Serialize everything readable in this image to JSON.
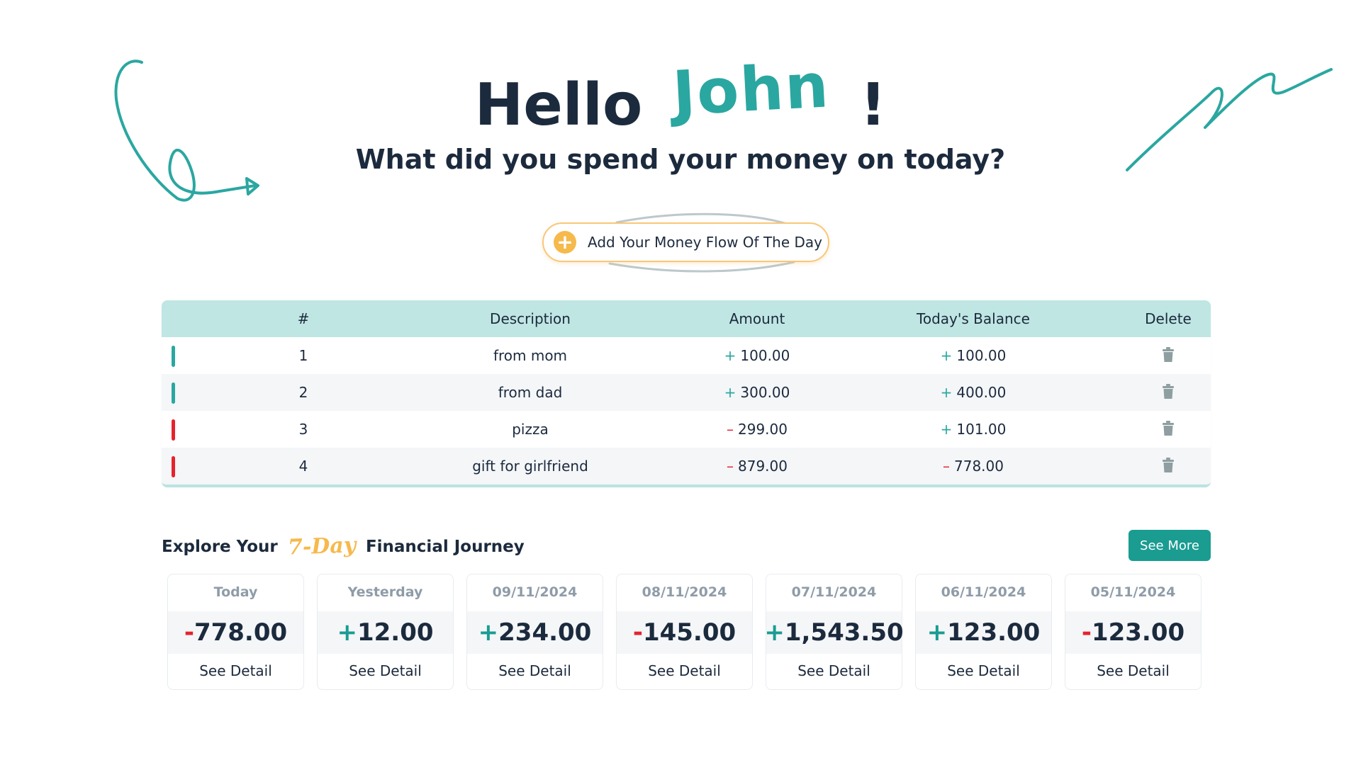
{
  "hero": {
    "greeting": "Hello",
    "name": "John",
    "exclaim": "!",
    "subtitle": "What did you spend your money on today?"
  },
  "add_button": {
    "label": "Add Your Money Flow Of The Day",
    "icon": "plus-circle-icon"
  },
  "colors": {
    "accent": "#2aa7a0",
    "positive": "#2aa7a0",
    "negative": "#e5232e",
    "button": "#1a9c91",
    "highlight": "#f6b94c",
    "header_bg": "#bfe6e3"
  },
  "table": {
    "headers": [
      "#",
      "Description",
      "Amount",
      "Today's Balance",
      "Delete"
    ],
    "rows": [
      {
        "num": "1",
        "desc": "from mom",
        "amt_sign": "+",
        "amt": "100.00",
        "bal_sign": "+",
        "bal": "100.00",
        "type": "income"
      },
      {
        "num": "2",
        "desc": "from dad",
        "amt_sign": "+",
        "amt": "300.00",
        "bal_sign": "+",
        "bal": "400.00",
        "type": "income"
      },
      {
        "num": "3",
        "desc": "pizza",
        "amt_sign": "–",
        "amt": "299.00",
        "bal_sign": "+",
        "bal": "101.00",
        "type": "expense"
      },
      {
        "num": "4",
        "desc": "gift for girlfriend",
        "amt_sign": "–",
        "amt": "879.00",
        "bal_sign": "–",
        "bal": "778.00",
        "type": "expense"
      }
    ]
  },
  "journey": {
    "title_before": "Explore Your",
    "highlight": "7-Day",
    "title_after": "Financial Journey",
    "see_more": "See More",
    "cards": [
      {
        "date": "Today",
        "sign": "-",
        "value": "778.00",
        "link": "See Detail"
      },
      {
        "date": "Yesterday",
        "sign": "+",
        "value": "12.00",
        "link": "See Detail"
      },
      {
        "date": "09/11/2024",
        "sign": "+",
        "value": "234.00",
        "link": "See Detail"
      },
      {
        "date": "08/11/2024",
        "sign": "-",
        "value": "145.00",
        "link": "See Detail"
      },
      {
        "date": "07/11/2024",
        "sign": "+",
        "value": "1,543.50",
        "link": "See Detail"
      },
      {
        "date": "06/11/2024",
        "sign": "+",
        "value": "123.00",
        "link": "See Detail"
      },
      {
        "date": "05/11/2024",
        "sign": "-",
        "value": "123.00",
        "link": "See Detail"
      }
    ]
  }
}
